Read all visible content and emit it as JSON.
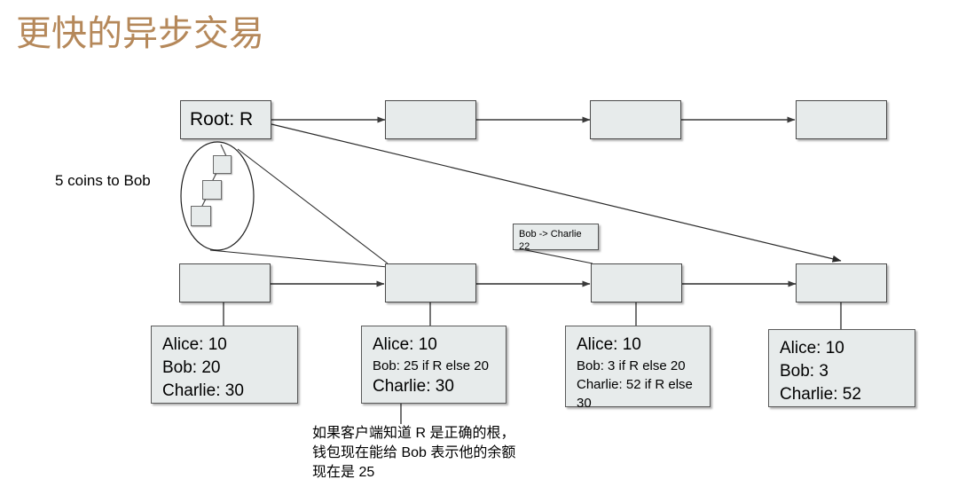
{
  "slide": {
    "title": "更快的异步交易",
    "title_color": "#b5885a",
    "background": "#ffffff",
    "box_fill": "#e7ebeb",
    "box_stroke": "#4a4a4a"
  },
  "root_node": {
    "label": "Root: R"
  },
  "callout": {
    "label": "5 coins to Bob"
  },
  "top_chain": [
    {
      "label": ""
    },
    {
      "label": ""
    },
    {
      "label": ""
    }
  ],
  "bottom_chain": [
    {
      "label": ""
    },
    {
      "label": ""
    },
    {
      "label": ""
    },
    {
      "label": ""
    }
  ],
  "tx_box": {
    "line1": "Bob -> Charlie",
    "line2": "22"
  },
  "balance_boxes": [
    {
      "lines": [
        {
          "text": "Alice: 10",
          "size": "lg"
        },
        {
          "text": "Bob: 20",
          "size": "lg"
        },
        {
          "text": "Charlie: 30",
          "size": "lg"
        }
      ]
    },
    {
      "lines": [
        {
          "text": "Alice: 10",
          "size": "lg"
        },
        {
          "text": "Bob: 25 if R else 20",
          "size": "sm"
        },
        {
          "text": "Charlie: 30",
          "size": "lg"
        }
      ]
    },
    {
      "lines": [
        {
          "text": "Alice: 10",
          "size": "lg"
        },
        {
          "text": "Bob: 3 if R else 20",
          "size": "sm"
        },
        {
          "text": "Charlie: 52 if R else",
          "size": "sm"
        },
        {
          "text": "30",
          "size": "sm"
        }
      ]
    },
    {
      "lines": [
        {
          "text": "Alice: 10",
          "size": "lg"
        },
        {
          "text": "Bob: 3",
          "size": "lg"
        },
        {
          "text": "Charlie: 52",
          "size": "lg"
        }
      ]
    }
  ],
  "caption": {
    "line1": "如果客户端知道 R 是正确的根，",
    "line2": "钱包现在能给 Bob 表示他的余额",
    "line3": "现在是 25"
  }
}
